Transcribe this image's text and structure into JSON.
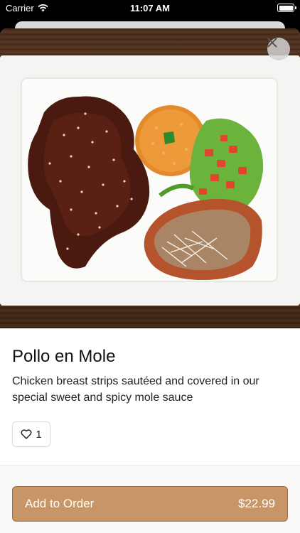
{
  "status_bar": {
    "carrier": "Carrier",
    "time": "11:07 AM"
  },
  "item": {
    "title": "Pollo en Mole",
    "description": "Chicken breast strips sautéed and covered in our special sweet and spicy mole sauce",
    "likes": "1"
  },
  "order_button": {
    "label": "Add to Order",
    "price": "$22.99"
  },
  "colors": {
    "accent": "#c89567",
    "accent_border": "#9c6c45"
  },
  "icons": {
    "close": "close-icon",
    "like": "heart-outline-icon",
    "wifi": "wifi-icon",
    "battery": "battery-icon"
  }
}
